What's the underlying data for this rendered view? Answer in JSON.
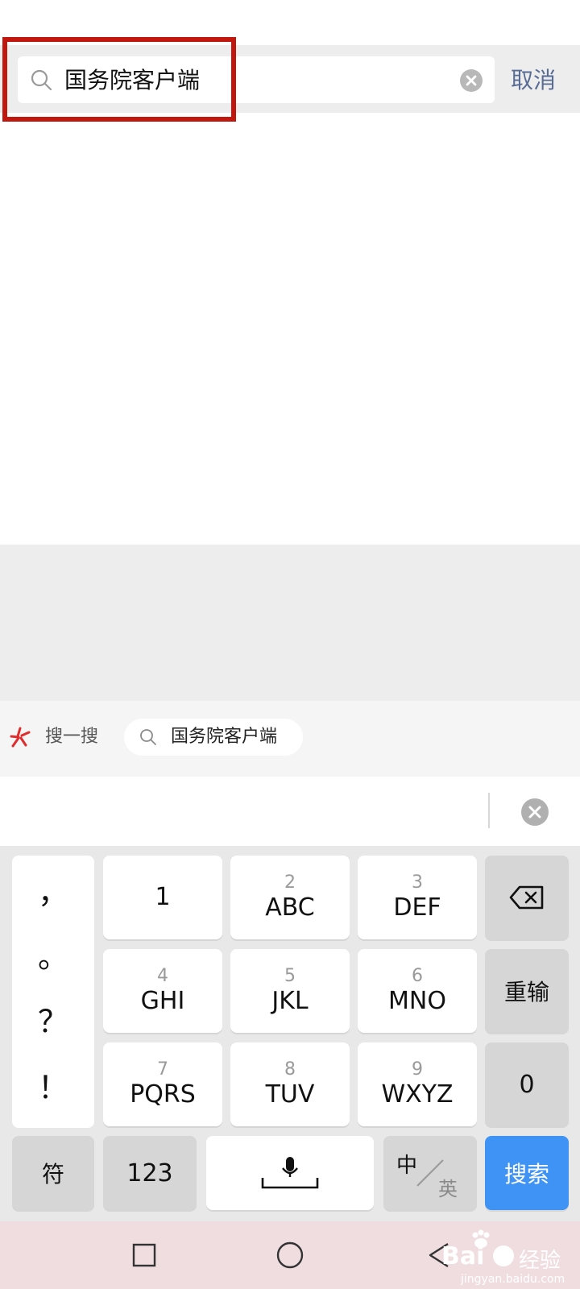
{
  "search": {
    "query": "国务院客户端",
    "cancel_label": "取消"
  },
  "suggestion": {
    "brand_label": "搜一搜",
    "chip_text": "国务院客户端"
  },
  "keyboard": {
    "punctuation": [
      "，",
      "。",
      "？",
      "！"
    ],
    "keys": {
      "k1": {
        "num": "",
        "letters": "1"
      },
      "k2": {
        "num": "2",
        "letters": "ABC"
      },
      "k3": {
        "num": "3",
        "letters": "DEF"
      },
      "k4": {
        "num": "4",
        "letters": "GHI"
      },
      "k5": {
        "num": "5",
        "letters": "JKL"
      },
      "k6": {
        "num": "6",
        "letters": "MNO"
      },
      "k7": {
        "num": "7",
        "letters": "PQRS"
      },
      "k8": {
        "num": "8",
        "letters": "TUV"
      },
      "k9": {
        "num": "9",
        "letters": "WXYZ"
      }
    },
    "reenter_label": "重输",
    "zero_label": "0",
    "symbol_label": "符",
    "num_label": "123",
    "lang_cn": "中",
    "lang_en": "英",
    "search_label": "搜索"
  },
  "watermark": {
    "brand": "Bai",
    "brand_cn": "经验",
    "url": "jingyan.baidu.com"
  },
  "colors": {
    "accent_blue": "#3f93f5",
    "cancel_text": "#576b95",
    "highlight_red": "#c0180e"
  }
}
